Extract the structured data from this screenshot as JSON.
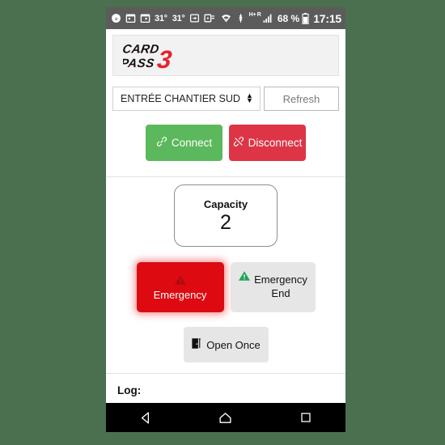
{
  "statusbar": {
    "icons": [
      "alarm-icon",
      "calendar-icon",
      "calendar-icon-2",
      "weather-icon",
      "weather-icon-2",
      "sync-icon",
      "mail-icon"
    ],
    "temp_1": "31°",
    "temp_2": "31°",
    "network_type": "H+",
    "roaming": "R",
    "battery_percent": "68 %",
    "clock": "17:15"
  },
  "app": {
    "logo": {
      "line1": "CARD",
      "line2": "PASS",
      "big": "3",
      "alt": "card-pass-3-logo"
    },
    "select": {
      "value": "ENTRÉE CHANTIER SUD",
      "arrow_up": "▲",
      "arrow_down": "▼"
    },
    "refresh_label": "Refresh",
    "connect_label": "Connect",
    "disconnect_label": "Disconnect",
    "capacity": {
      "label": "Capacity",
      "value": "2"
    },
    "emergency_label": "Emergency",
    "emergency_end_line1": "Emergency",
    "emergency_end_line2": "End",
    "open_once_label": "Open Once",
    "log_label": "Log:"
  },
  "colors": {
    "background": "#4a7050",
    "statusbar": "#5b5b5b",
    "connect_green": "#5cb85c",
    "disconnect_red": "#dd3545",
    "emergency_red": "#dd0b11",
    "emergency_glow": "#f47878",
    "button_gray": "#e6e6e6",
    "logo_red": "#e8212a"
  },
  "navbar": {
    "back": "back-triangle",
    "home": "home-pentagon",
    "recents": "recents-square"
  }
}
